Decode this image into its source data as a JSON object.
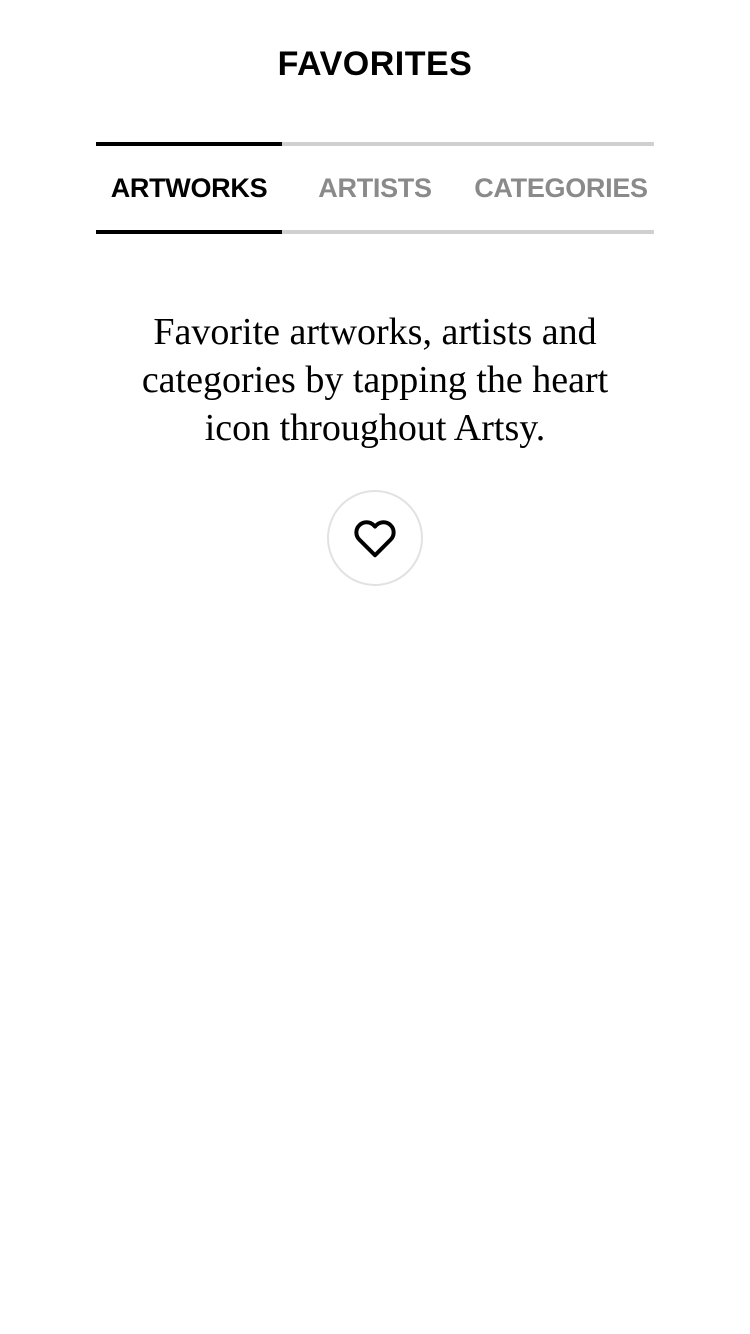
{
  "header": {
    "title": "FAVORITES"
  },
  "tabs": [
    {
      "label": "ARTWORKS",
      "active": true
    },
    {
      "label": "ARTISTS",
      "active": false
    },
    {
      "label": "CATEGORIES",
      "active": false
    }
  ],
  "empty_state": {
    "message": "Favorite artworks, artists and categories by tapping the heart icon throughout Artsy.",
    "icon": "heart-icon"
  },
  "colors": {
    "active_tab": "#000000",
    "inactive_tab": "#8a8a8a",
    "tab_border": "#d0d0d0",
    "button_border": "#e2e2e2",
    "background": "#ffffff"
  }
}
